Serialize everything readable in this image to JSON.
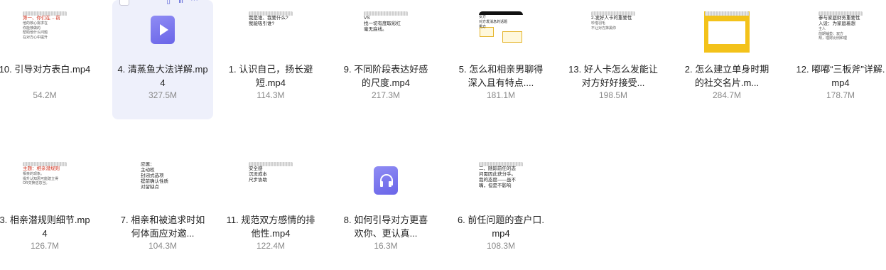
{
  "files": [
    {
      "name": "10. 引导对方表白.mp4",
      "size": "54.2M",
      "thumb": {
        "style": "doc",
        "lines": [
          "第一、你们在 ...前",
          "",
          "他的核心需求在",
          "你能够做的",
          "帮助他什么问题",
          "在对方心中提升"
        ]
      }
    },
    {
      "name": "4. 清蒸鱼大法详解.mp4",
      "size": "327.5M",
      "selected": true,
      "icon": "video-file-icon"
    },
    {
      "name": "1. 认识自己，扬长避短.mp4",
      "size": "114.3M",
      "thumb": {
        "style": "doc",
        "lines": [
          "",
          "我是谁、我要什么?",
          "我能吸引谁?"
        ]
      }
    },
    {
      "name": "9. 不同阶段表达好感的尺度.mp4",
      "size": "217.3M",
      "thumb": {
        "style": "doc",
        "lines": [
          "VS",
          "",
          "找一切有度取彩红",
          "毫无底线。"
        ]
      }
    },
    {
      "name": "5. 怎么和相亲男聊得深入且有特点....",
      "size": "181.1M",
      "thumb": {
        "style": "boxes",
        "lines": [
          "",
          "",
          "女方",
          "对方发消息的话题",
          "男方"
        ]
      }
    },
    {
      "name": "13. 好人卡怎么发能让对方好好接受...",
      "size": "198.5M",
      "thumb": {
        "style": "doc",
        "lines": [
          "",
          "2.发好人卡的重要性",
          "",
          "珍惜羽毛",
          "不让对方抹黑你"
        ]
      }
    },
    {
      "name": "2. 怎么建立单身时期的社交名片.m...",
      "size": "284.7M",
      "thumb": {
        "style": "yellow",
        "lines": []
      }
    },
    {
      "name": "12. 嘟嘟“三板斧”详解.mp4",
      "size": "178.7M",
      "thumb": {
        "style": "doc",
        "lines": [
          "参与家庭财务重要性",
          "入设：为家庭着想",
          "主人",
          "前期铺垫：双方",
          "规，理财比例和理"
        ]
      }
    },
    {
      "name": "3. 相亲潜规则细节.mp4",
      "size": "126.7M",
      "thumb": {
        "style": "doc",
        "lines": [
          "主题：相亲潜规则",
          "",
          "相亲的现象。",
          "提升认知思可能建立得",
          "OR交换信息当。"
        ]
      }
    },
    {
      "name": "7. 相亲和被追求时如何体面应对邀...",
      "size": "104.3M",
      "thumb": {
        "style": "docnobar",
        "lines": [
          "应邀：",
          "主动权",
          "封闭式选项",
          "提前确认性质",
          "对留缺点"
        ]
      }
    },
    {
      "name": "11. 规范双方感情的排他性.mp4",
      "size": "122.4M",
      "thumb": {
        "style": "doc",
        "lines": [
          "",
          "安全感",
          "沉没成本",
          "尺步协助"
        ]
      }
    },
    {
      "name": "8. 如何引导对方更喜欢你、更认真...",
      "size": "16.3M",
      "icon": "audio-file-icon"
    },
    {
      "name": "6. 前任问题的查户口.mp4",
      "size": "108.3M",
      "thumb": {
        "style": "doc",
        "lines": [
          "二、随踪前任的态",
          "问需因此获分手。",
          "我的态度——虽不",
          "嘴，但是不影响"
        ]
      }
    }
  ],
  "hover": {
    "checkbox": "select-checkbox",
    "tools": [
      "phone-icon",
      "share-icon",
      "more-icon"
    ]
  },
  "colors": {
    "accent": "#6a65e8",
    "selected_bg": "#eef0fb",
    "size_text": "#8a8a8a"
  }
}
